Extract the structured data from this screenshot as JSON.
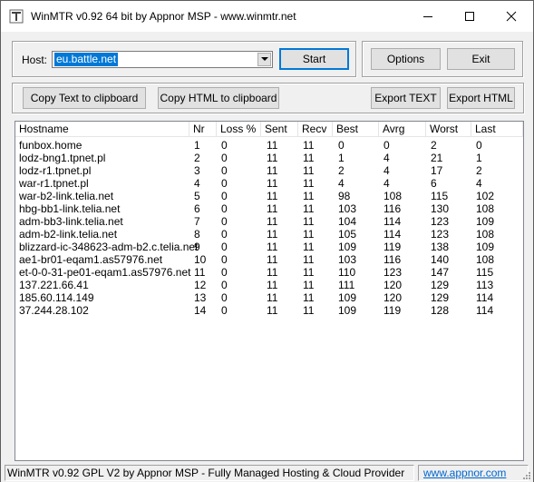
{
  "window": {
    "title": "WinMTR v0.92 64 bit by Appnor MSP - www.winmtr.net"
  },
  "host": {
    "label": "Host:",
    "value": "eu.battle.net"
  },
  "buttons": {
    "start": "Start",
    "options": "Options",
    "exit": "Exit",
    "copy_text": "Copy Text to clipboard",
    "copy_html": "Copy HTML to clipboard",
    "export_text": "Export TEXT",
    "export_html": "Export HTML"
  },
  "table": {
    "columns": [
      "Hostname",
      "Nr",
      "Loss %",
      "Sent",
      "Recv",
      "Best",
      "Avrg",
      "Worst",
      "Last"
    ],
    "rows": [
      [
        "funbox.home",
        "1",
        "0",
        "11",
        "11",
        "0",
        "0",
        "2",
        "0"
      ],
      [
        "lodz-bng1.tpnet.pl",
        "2",
        "0",
        "11",
        "11",
        "1",
        "4",
        "21",
        "1"
      ],
      [
        "lodz-r1.tpnet.pl",
        "3",
        "0",
        "11",
        "11",
        "2",
        "4",
        "17",
        "2"
      ],
      [
        "war-r1.tpnet.pl",
        "4",
        "0",
        "11",
        "11",
        "4",
        "4",
        "6",
        "4"
      ],
      [
        "war-b2-link.telia.net",
        "5",
        "0",
        "11",
        "11",
        "98",
        "108",
        "115",
        "102"
      ],
      [
        "hbg-bb1-link.telia.net",
        "6",
        "0",
        "11",
        "11",
        "103",
        "116",
        "130",
        "108"
      ],
      [
        "adm-bb3-link.telia.net",
        "7",
        "0",
        "11",
        "11",
        "104",
        "114",
        "123",
        "109"
      ],
      [
        "adm-b2-link.telia.net",
        "8",
        "0",
        "11",
        "11",
        "105",
        "114",
        "123",
        "108"
      ],
      [
        "blizzard-ic-348623-adm-b2.c.telia.net",
        "9",
        "0",
        "11",
        "11",
        "109",
        "119",
        "138",
        "109"
      ],
      [
        "ae1-br01-eqam1.as57976.net",
        "10",
        "0",
        "11",
        "11",
        "103",
        "116",
        "140",
        "108"
      ],
      [
        "et-0-0-31-pe01-eqam1.as57976.net",
        "11",
        "0",
        "11",
        "11",
        "110",
        "123",
        "147",
        "115"
      ],
      [
        "137.221.66.41",
        "12",
        "0",
        "11",
        "11",
        "111",
        "120",
        "129",
        "113"
      ],
      [
        "185.60.114.149",
        "13",
        "0",
        "11",
        "11",
        "109",
        "120",
        "129",
        "114"
      ],
      [
        "37.244.28.102",
        "14",
        "0",
        "11",
        "11",
        "109",
        "119",
        "128",
        "114"
      ]
    ]
  },
  "status": {
    "text": "WinMTR v0.92 GPL V2 by Appnor MSP - Fully Managed Hosting & Cloud Provider",
    "link": "www.appnor.com"
  },
  "colors": {
    "selection": "#0078d7",
    "link": "#0066cc"
  }
}
